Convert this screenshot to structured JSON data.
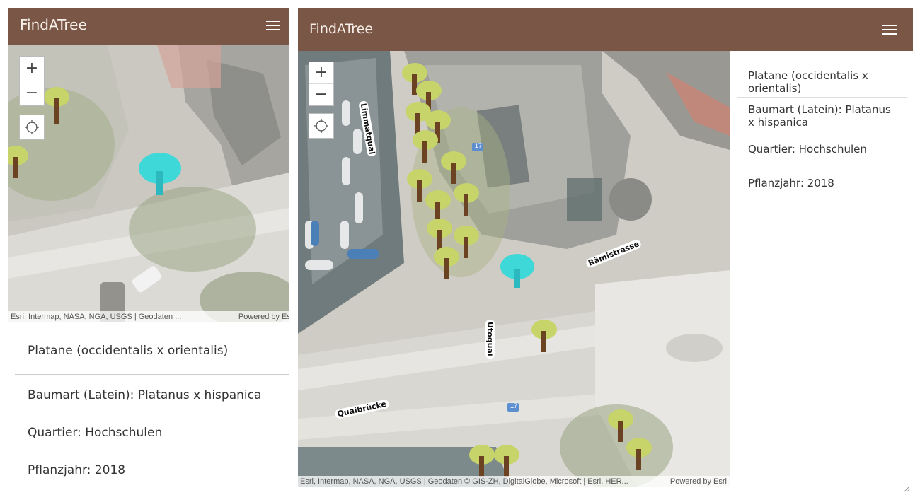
{
  "left_panel": {
    "navbar": {
      "brand": "FindATree",
      "menu_icon": "hamburger-icon"
    },
    "map": {
      "zoom_in": "+",
      "zoom_out": "−",
      "locate_icon": "locate-crosshair-icon",
      "attribution": "Esri, Intermap, NASA, NGA, USGS | Geodaten ...",
      "powered_by": "Powered by Esri"
    },
    "info": {
      "title": "Platane (occidentalis x orientalis)",
      "species": "Baumart (Latein): Platanus x hispanica",
      "quarter": "Quartier: Hochschulen",
      "year": "Pflanzjahr: 2018"
    }
  },
  "right_panel": {
    "navbar": {
      "brand": "FindATree",
      "menu_icon": "hamburger-icon"
    },
    "map": {
      "zoom_in": "+",
      "zoom_out": "−",
      "locate_icon": "locate-crosshair-icon",
      "attribution": "Esri, Intermap, NASA, NGA, USGS | Geodaten © GIS-ZH, DigitalGlobe, Microsoft | Esri, HER...",
      "powered_by": "Powered by Esri",
      "labels": {
        "limmatquai": "Limmatquai",
        "utoquai": "Utoquai",
        "quaibruecke": "Quaibrücke",
        "raemistrasse": "Rämistrasse",
        "route": "17"
      }
    },
    "info": {
      "title": "Platane (occidentalis x orientalis)",
      "species": "Baumart (Latein): Platanus x hispanica",
      "quarter": "Quartier: Hochschulen",
      "year": "Pflanzjahr: 2018"
    }
  },
  "colors": {
    "navbar": "#7a5646",
    "tree_foliage": "#c7d46a",
    "tree_trunk": "#6b4323",
    "selected_tree": "#3fd8d8"
  }
}
